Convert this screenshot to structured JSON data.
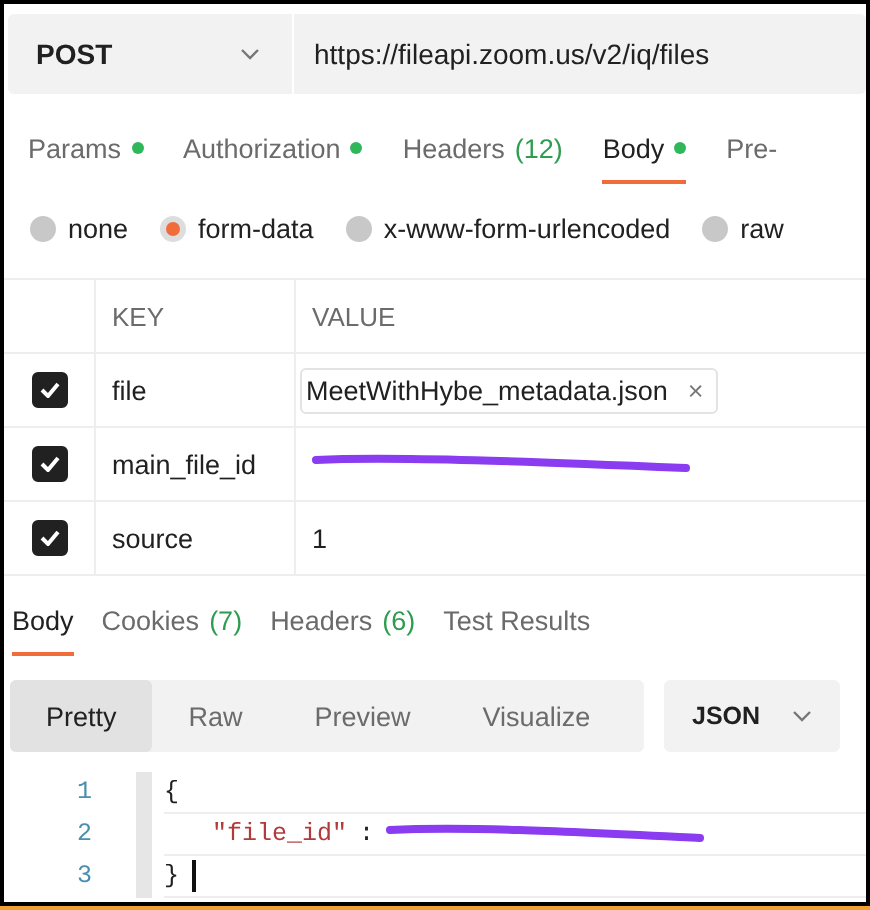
{
  "request": {
    "method": "POST",
    "url": "https://fileapi.zoom.us/v2/iq/files"
  },
  "request_tabs": [
    {
      "label": "Params",
      "dot": true,
      "selected": false
    },
    {
      "label": "Authorization",
      "dot": true,
      "selected": false
    },
    {
      "label": "Headers",
      "count": "(12)",
      "dot": false,
      "selected": false
    },
    {
      "label": "Body",
      "dot": true,
      "selected": true
    },
    {
      "label": "Pre-",
      "dot": false,
      "selected": false
    }
  ],
  "body_types": [
    {
      "label": "none",
      "selected": false
    },
    {
      "label": "form-data",
      "selected": true
    },
    {
      "label": "x-www-form-urlencoded",
      "selected": false
    },
    {
      "label": "raw",
      "selected": false
    }
  ],
  "params_table": {
    "columns": [
      "KEY",
      "VALUE"
    ],
    "rows": [
      {
        "checked": true,
        "key": "file",
        "kind": "file",
        "value": "MeetWithHybe_metadata.json",
        "remove": "×"
      },
      {
        "checked": true,
        "key": "main_file_id",
        "kind": "redacted"
      },
      {
        "checked": true,
        "key": "source",
        "kind": "text",
        "value": "1"
      }
    ]
  },
  "response": {
    "tabs": [
      {
        "label": "Body",
        "selected": true
      },
      {
        "label": "Cookies",
        "count": "(7)",
        "selected": false
      },
      {
        "label": "Headers",
        "count": "(6)",
        "selected": false
      },
      {
        "label": "Test Results",
        "selected": false
      }
    ],
    "views": [
      {
        "label": "Pretty",
        "selected": true
      },
      {
        "label": "Raw",
        "selected": false
      },
      {
        "label": "Preview",
        "selected": false
      },
      {
        "label": "Visualize",
        "selected": false
      }
    ],
    "format": "JSON",
    "lines": [
      {
        "number": "1",
        "tokens": [
          {
            "kind": "punct",
            "text": "{"
          }
        ]
      },
      {
        "number": "2",
        "tokens": [
          {
            "kind": "key",
            "text": "\"file_id\""
          },
          {
            "kind": "punct",
            "text": ":"
          },
          {
            "kind": "redacted"
          }
        ]
      },
      {
        "number": "3",
        "tokens": [
          {
            "kind": "punct",
            "text": "}"
          }
        ],
        "cursor": true
      }
    ]
  }
}
